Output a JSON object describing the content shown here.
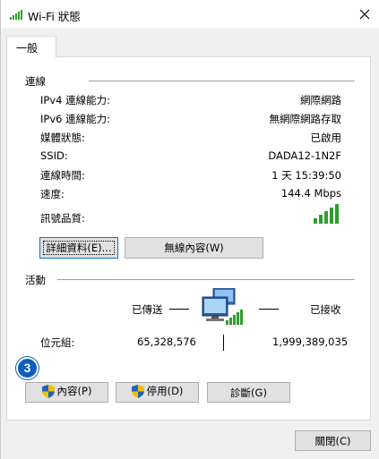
{
  "window": {
    "title": "Wi-Fi 狀態",
    "close_label": "×"
  },
  "tabs": [
    {
      "label": "一般"
    }
  ],
  "connection": {
    "section_title": "連線",
    "rows": [
      {
        "label": "IPv4 連線能力:",
        "value": "網際網路"
      },
      {
        "label": "IPv6 連線能力:",
        "value": "無網際網路存取"
      },
      {
        "label": "媒體狀態:",
        "value": "已啟用"
      },
      {
        "label": "SSID:",
        "value": "DADA12-1N2F"
      },
      {
        "label": "連線時間:",
        "value": "1 天 15:39:50"
      },
      {
        "label": "速度:",
        "value": "144.4 Mbps"
      }
    ],
    "signal_label": "訊號品質:",
    "signal_bars_lit": 5,
    "details_button": "詳細資料(E)...",
    "wireless_props_button": "無線內容(W)"
  },
  "activity": {
    "section_title": "活動",
    "sent_label": "已傳送",
    "received_label": "已接收",
    "bytes_label": "位元組:",
    "bytes_sent": "65,328,576",
    "bytes_received": "1,999,389,035"
  },
  "buttons": {
    "properties": "內容(P)",
    "disable": "停用(D)",
    "diagnose": "診斷(G)",
    "close": "關閉(C)"
  },
  "annotation_badge": "3",
  "colors": {
    "signal_green": "#2e9e2e",
    "badge_blue": "#0a5fbf",
    "uac_blue": "#1f62c5",
    "uac_yellow": "#f2c200"
  }
}
